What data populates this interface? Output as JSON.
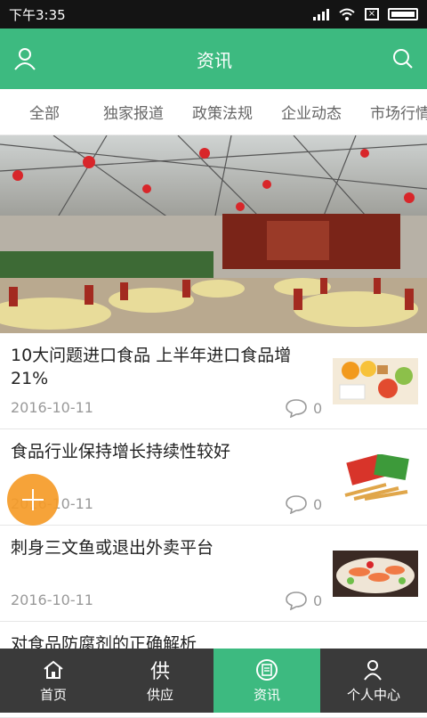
{
  "status_bar": {
    "time": "下午3:35"
  },
  "header": {
    "title": "资讯"
  },
  "tabs": [
    {
      "label": "全部"
    },
    {
      "label": "独家报道"
    },
    {
      "label": "政策法规"
    },
    {
      "label": "企业动态"
    },
    {
      "label": "市场行情"
    }
  ],
  "articles": [
    {
      "title": "10大问题进口食品 上半年进口食品增21%",
      "date": "2016-10-11",
      "comments": "0"
    },
    {
      "title": "食品行业保持增长持续性较好",
      "date": "2016-10-11",
      "comments": "0"
    },
    {
      "title": "刺身三文鱼或退出外卖平台",
      "date": "2016-10-11",
      "comments": "0"
    },
    {
      "title": "对食品防腐剂的正确解析",
      "date": "",
      "comments": ""
    }
  ],
  "bottom_nav": [
    {
      "label": "首页",
      "icon": "home-icon"
    },
    {
      "label": "供应",
      "icon_text": "供"
    },
    {
      "label": "资讯",
      "icon": "news-icon"
    },
    {
      "label": "个人中心",
      "icon": "user-icon"
    }
  ],
  "colors": {
    "primary": "#3dba80",
    "fab": "#f59b28",
    "nav_bg": "#3a3a3a"
  }
}
